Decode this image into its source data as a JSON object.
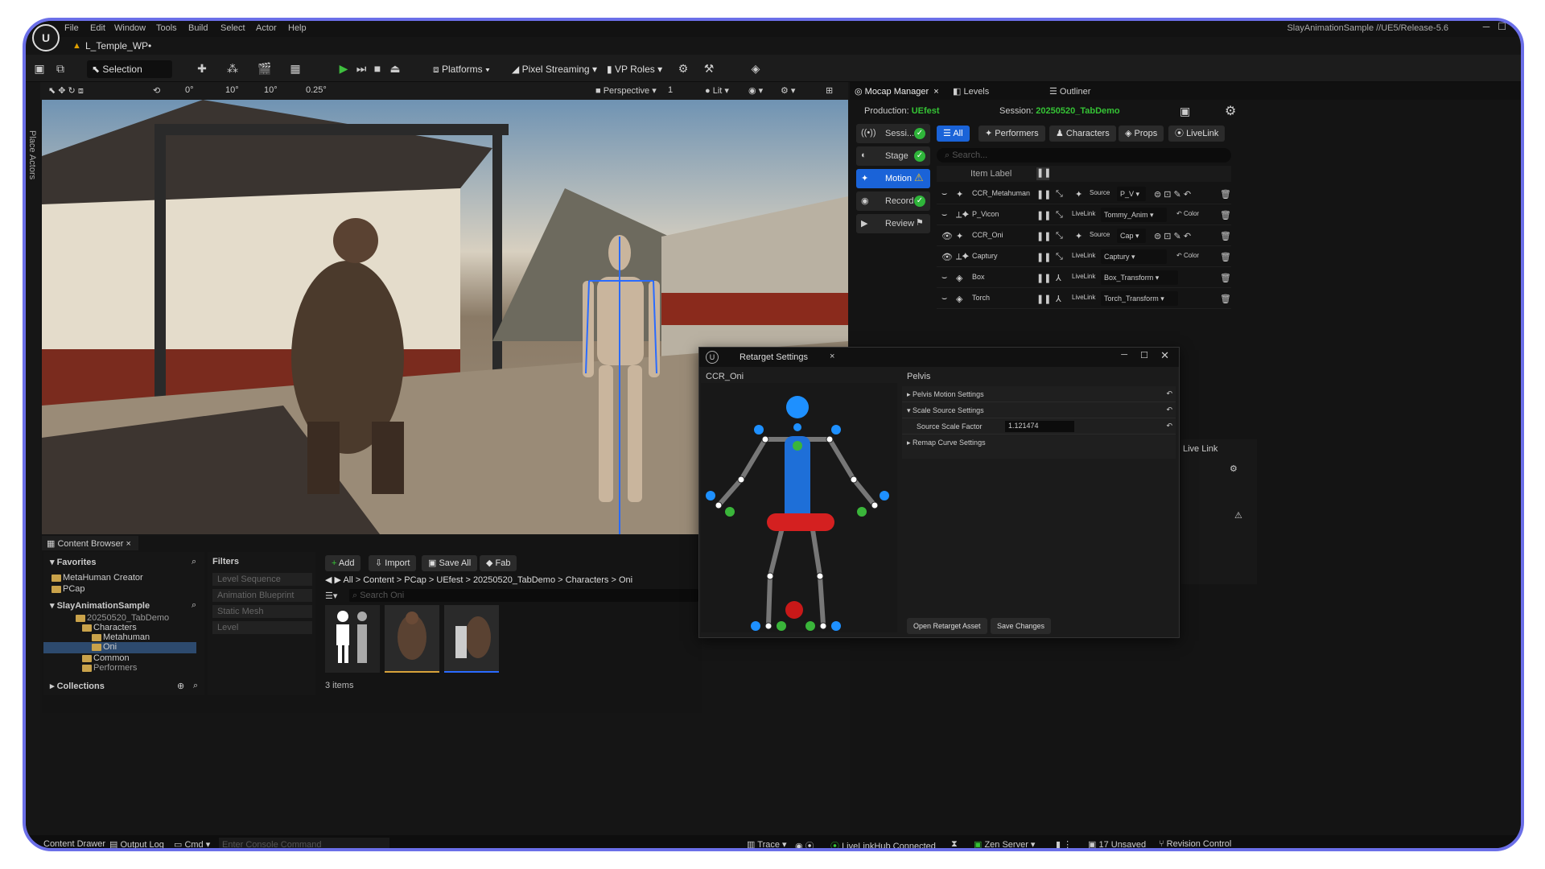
{
  "menu": {
    "items": [
      "File",
      "Edit",
      "Window",
      "Tools",
      "Build",
      "Select",
      "Actor",
      "Help"
    ],
    "project": "SlayAnimationSample //UE5/Release-5.6",
    "logo": "U"
  },
  "level_tab": "L_Temple_WP•",
  "toolbar": {
    "selection_mode": "Selection Mode",
    "platforms": "Platforms",
    "pixel_streaming": "Pixel Streaming",
    "vp_roles": "VP Roles"
  },
  "viewport_toolbar": {
    "move": "0°",
    "grid": "10°",
    "rot": "10°",
    "scale": "0.25°",
    "perspective": "Perspective",
    "cams": "1",
    "lit": "Lit"
  },
  "place_actors": "Place Actors",
  "content_browser": {
    "tab": "Content Browser",
    "favorites": "Favorites",
    "fav_items": [
      "MetaHuman Creator",
      "PCap"
    ],
    "project": "SlayAnimationSample",
    "tree": [
      "20250520_TabDemo",
      "Characters",
      "Metahuman",
      "Oni",
      "Common",
      "Performers"
    ],
    "collections": "Collections",
    "filters": "Filters",
    "filter_items": [
      "Level Sequence",
      "Animation Blueprint",
      "Static Mesh",
      "Level"
    ],
    "add": "Add",
    "import": "Import",
    "save_all": "Save All",
    "fab": "Fab",
    "path": [
      "All",
      "Content",
      "PCap",
      "UEfest",
      "20250520_TabDemo",
      "Characters",
      "Oni"
    ],
    "search_placeholder": "Search Oni",
    "items_count": "3 items"
  },
  "mocap": {
    "tab": "Mocap Manager",
    "levels_tab": "Levels",
    "outliner_tab": "Outliner",
    "production_label": "Production:",
    "production": "UEfest",
    "session_label": "Session:",
    "session": "20250520_TabDemo",
    "steps": [
      {
        "label": "Sessi...",
        "status": "ok"
      },
      {
        "label": "Stage",
        "status": "ok"
      },
      {
        "label": "Motion",
        "status": "warn"
      },
      {
        "label": "Record",
        "status": "ok"
      },
      {
        "label": "Review",
        "status": "flag"
      }
    ],
    "filters": [
      "All",
      "Performers",
      "Characters",
      "Props",
      "LiveLink"
    ],
    "search_placeholder": "Search...",
    "item_label_header": "Item Label",
    "rows": [
      {
        "name": "CCR_Metahuman",
        "mode": "Source",
        "value": "P_V"
      },
      {
        "name": "P_Vicon",
        "mode": "LiveLink",
        "value": "Tommy_Anim",
        "extra": "Color"
      },
      {
        "name": "CCR_Oni",
        "mode": "Source",
        "value": "Cap"
      },
      {
        "name": "Captury",
        "mode": "LiveLink",
        "value": "Captury",
        "extra": "Color"
      },
      {
        "name": "Box",
        "mode": "LiveLink",
        "value": "Box_Transform"
      },
      {
        "name": "Torch",
        "mode": "LiveLink",
        "value": "Torch_Transform"
      }
    ],
    "livelink_label": "Live Link"
  },
  "retarget": {
    "title": "Retarget Settings",
    "close": "×",
    "left_header": "CCR_Oni",
    "right_header": "Pelvis",
    "settings": [
      "Pelvis Motion Settings",
      "Scale Source Settings",
      "Source Scale Factor",
      "Remap Curve Settings"
    ],
    "scale_value": "1.121474",
    "open_btn": "Open Retarget Asset",
    "save_btn": "Save Changes"
  },
  "status": {
    "content_drawer": "Content Drawer",
    "output_log": "Output Log",
    "cmd": "Cmd",
    "console_placeholder": "Enter Console Command",
    "trace": "Trace",
    "livelink": "LiveLinkHub Connected",
    "zen": "Zen Server",
    "unsaved": "17 Unsaved",
    "revision": "Revision Control"
  }
}
